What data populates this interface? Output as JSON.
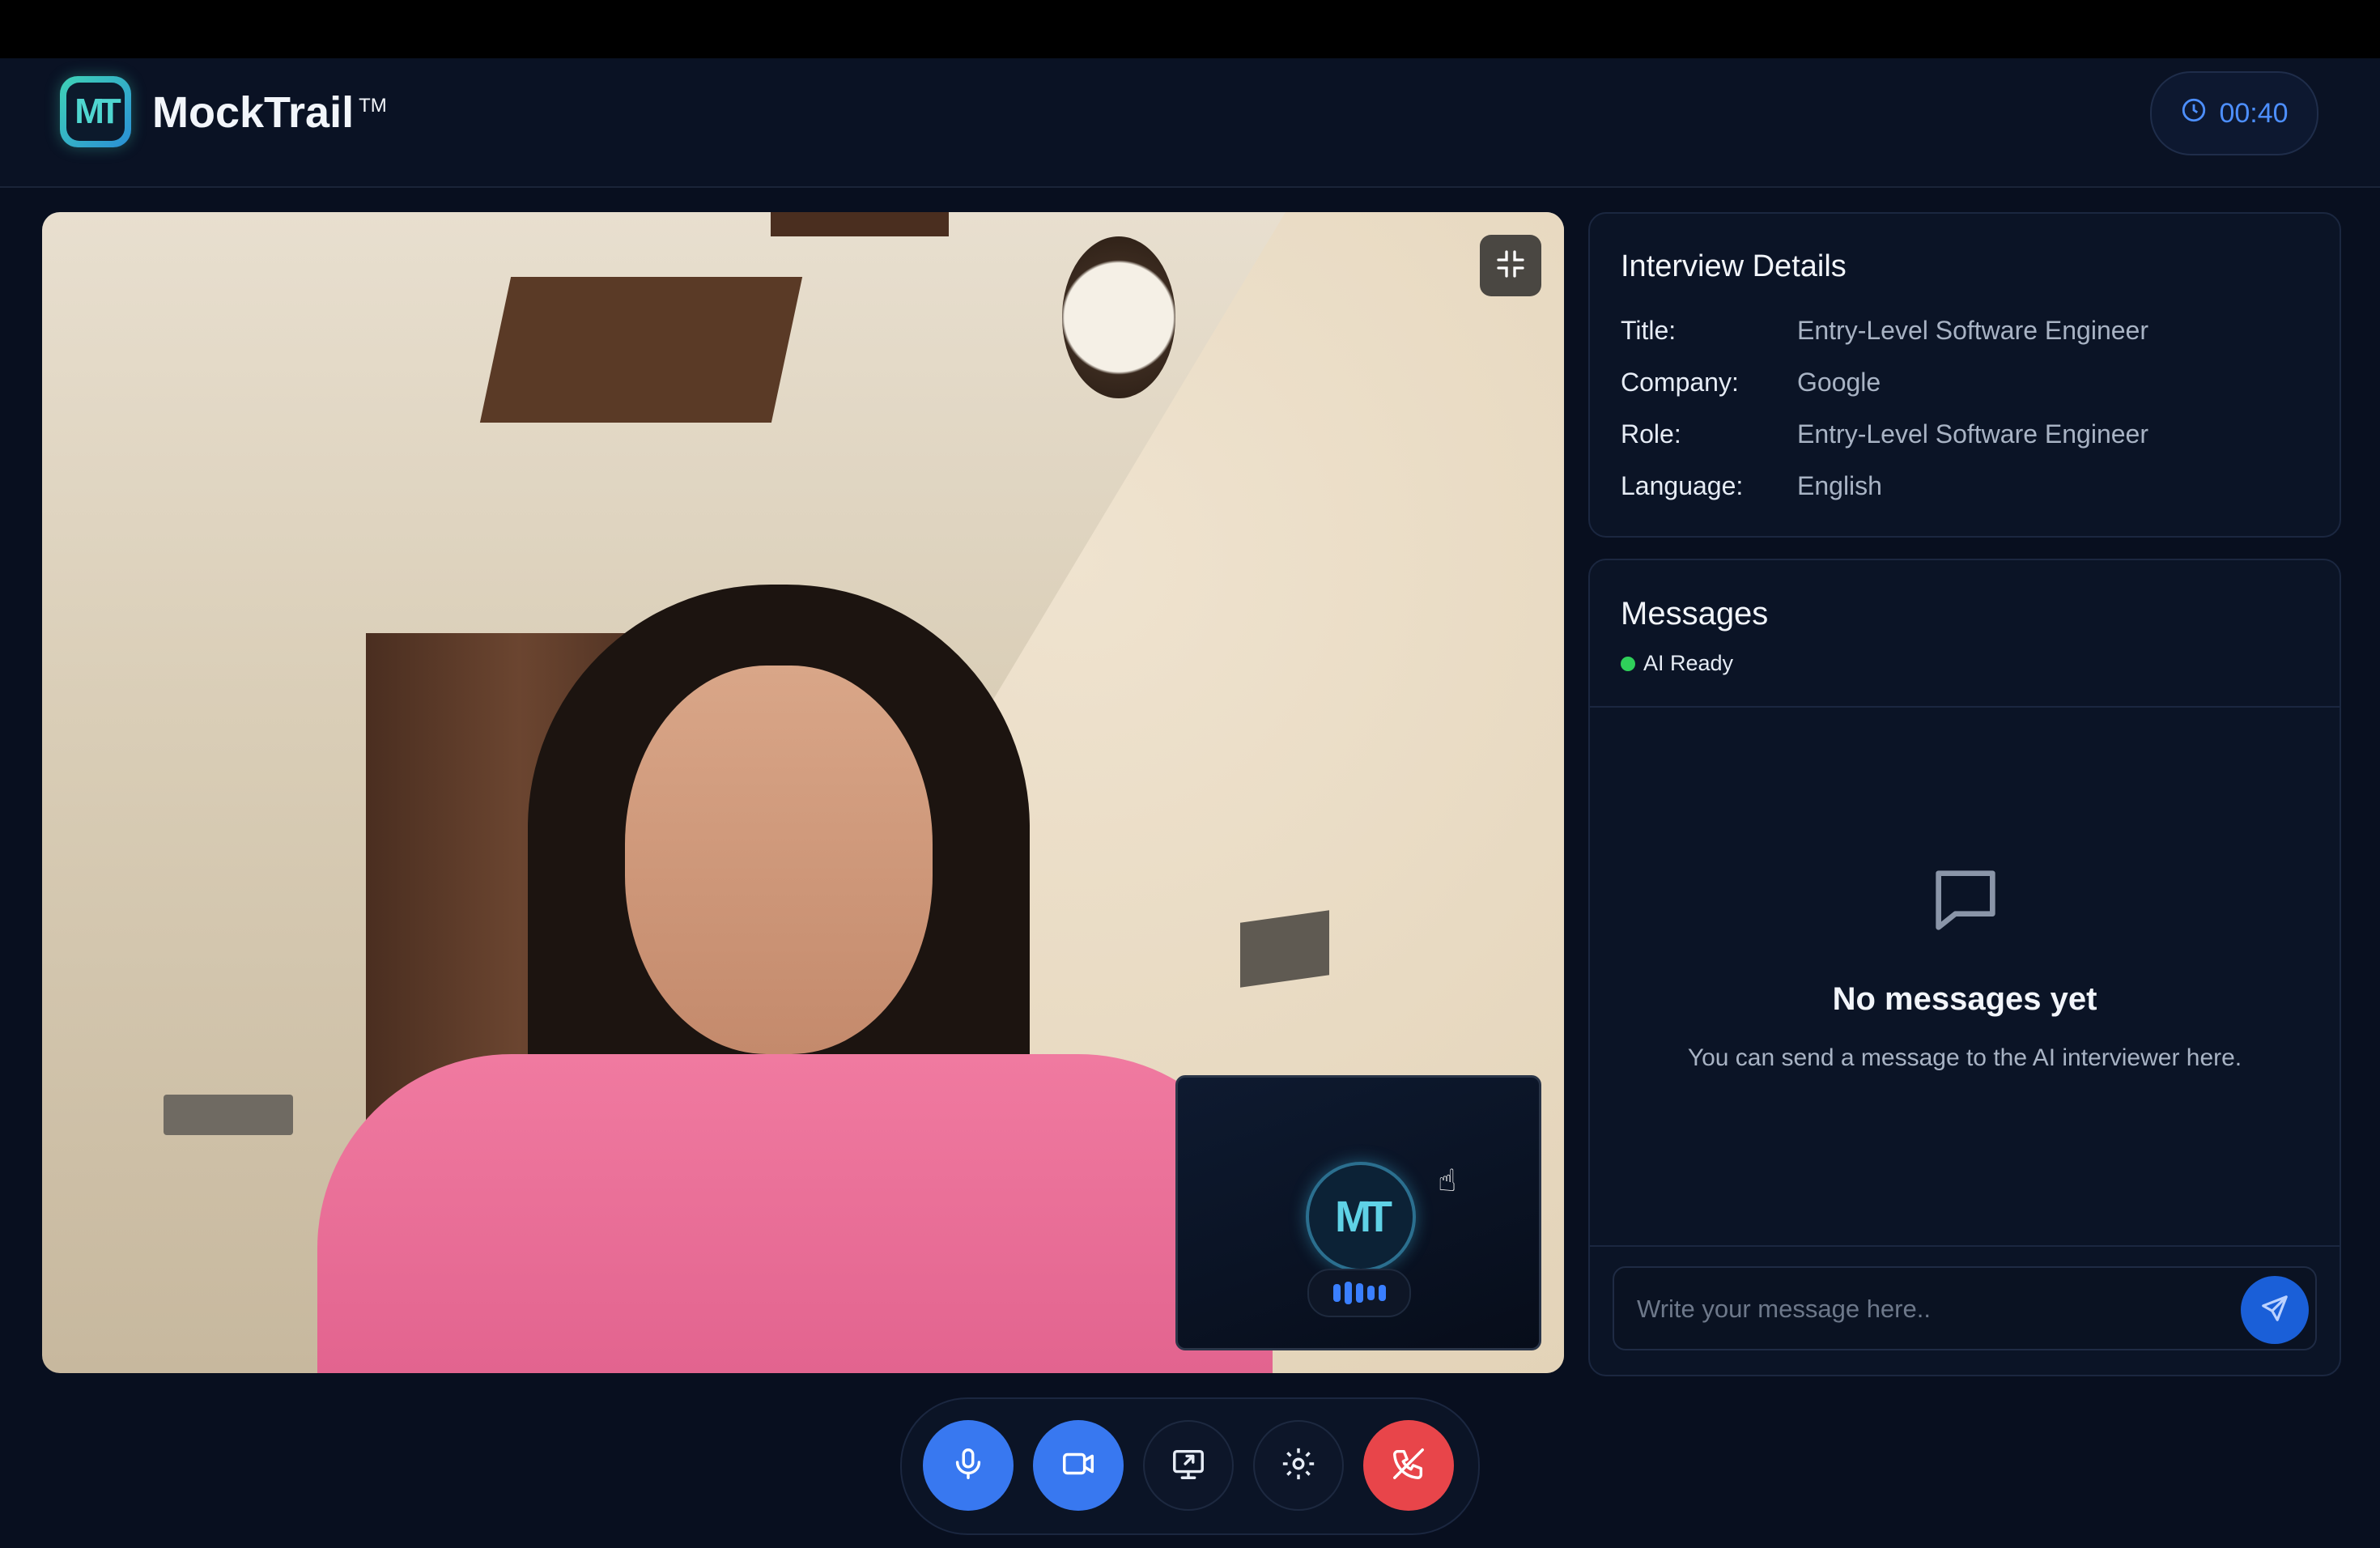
{
  "app": {
    "brand": "MockTrail",
    "trademark": "TM",
    "logo_letters": "MT"
  },
  "timer": {
    "value": "00:40",
    "icon": "clock-icon"
  },
  "video": {
    "minimize_icon": "minimize-icon",
    "pip_avatar_letters": "MT"
  },
  "details": {
    "heading": "Interview Details",
    "rows": [
      {
        "key": "Title:",
        "value": "Entry-Level Software Engineer"
      },
      {
        "key": "Company:",
        "value": "Google"
      },
      {
        "key": "Role:",
        "value": "Entry-Level Software Engineer"
      },
      {
        "key": "Language:",
        "value": "English"
      }
    ]
  },
  "messages": {
    "heading": "Messages",
    "status": "AI Ready",
    "status_color": "#2fd05a",
    "empty_title": "No messages yet",
    "empty_subtitle": "You can send a message to the AI interviewer here.",
    "input_placeholder": "Write your message here..",
    "input_value": "",
    "send_icon": "send-icon"
  },
  "controls": [
    {
      "name": "microphone",
      "icon": "mic-icon",
      "style": "blue"
    },
    {
      "name": "camera",
      "icon": "video-icon",
      "style": "blue"
    },
    {
      "name": "share-screen",
      "icon": "screen-share-icon",
      "style": "dark"
    },
    {
      "name": "settings",
      "icon": "gear-icon",
      "style": "dark"
    },
    {
      "name": "end-call",
      "icon": "phone-off-icon",
      "style": "red"
    }
  ],
  "colors": {
    "accent": "#3878f0",
    "danger": "#e8454a",
    "background": "#080f1f"
  }
}
